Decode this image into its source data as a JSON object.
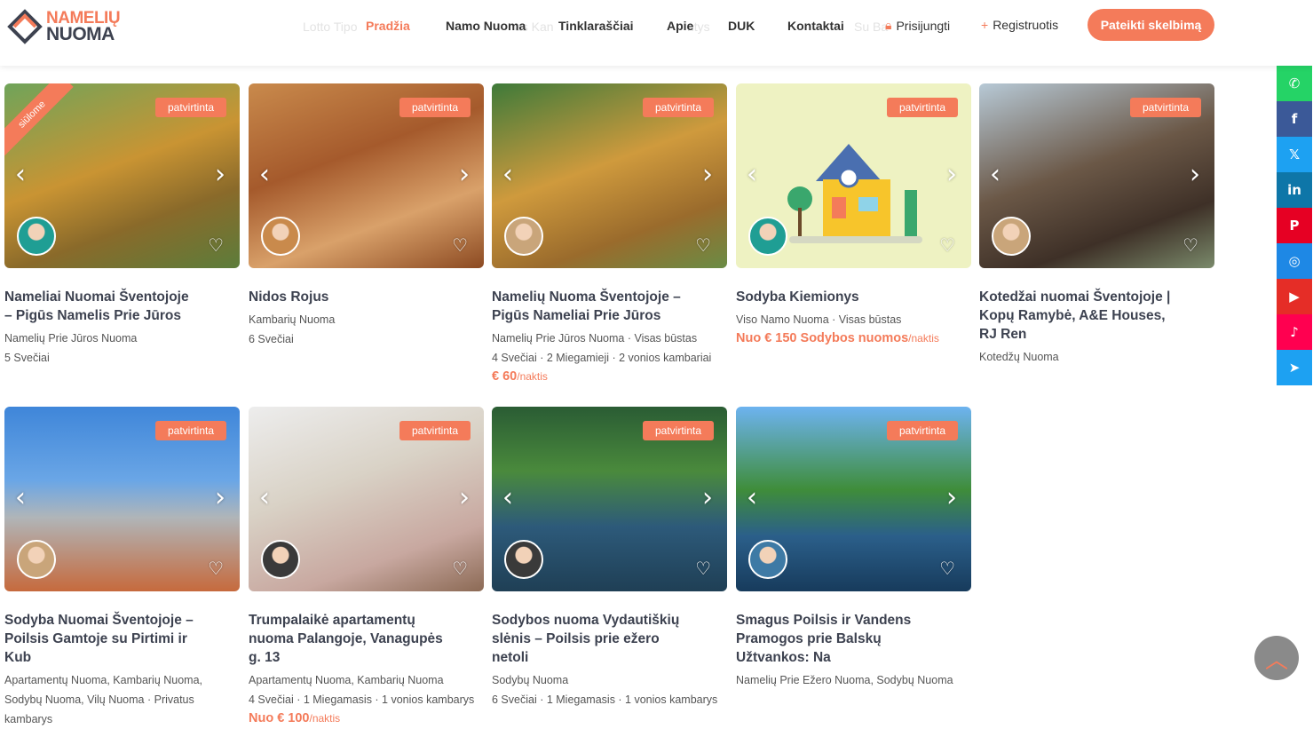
{
  "header": {
    "logo": {
      "line1": "NAMELIŲ",
      "line2": "NUOMA"
    },
    "ghost_links": [
      "Lotto Tipo",
      "as Kan",
      "ntys",
      "Su Ba"
    ],
    "nav": [
      "Pradžia",
      "Namo Nuoma",
      "Tinklaraščiai",
      "Apie",
      "DUK",
      "Kontaktai"
    ],
    "login": "Prisijungti",
    "register": "Registruotis",
    "cta": "Pateikti skelbimą"
  },
  "badge_label": "patvirtinta",
  "ribbon_label": "siūlome",
  "listings": [
    {
      "title": "Nameliai Nuomai Šventojoje – Pigūs Namelis Prie Jūros",
      "sub1": "Namelių Prie Jūros Nuoma",
      "sub2": "5 Svečiai",
      "price": "",
      "unit": ""
    },
    {
      "title": "Nidos Rojus",
      "sub1": "Kambarių Nuoma",
      "sub2": "6 Svečiai",
      "price": "",
      "unit": ""
    },
    {
      "title": "Namelių Nuoma Šventojoje – Pigūs Nameliai Prie Jūros",
      "sub1": "Namelių Prie Jūros Nuoma · Visas būstas",
      "sub2": "4 Svečiai · 2 Miegamieji · 2 vonios kambariai",
      "price": "€ 60",
      "unit": "/naktis"
    },
    {
      "title": "Sodyba Kiemionys",
      "sub1": "Viso Namo Nuoma · Visas būstas",
      "sub2": "",
      "price": "Nuo € 150 Sodybos nuomos",
      "unit": "/naktis"
    },
    {
      "title": "Kotedžai nuomai Šventojoje | Kopų Ramybė, A&E Houses, RJ Ren",
      "sub1": "Kotedžų Nuoma",
      "sub2": "",
      "price": "",
      "unit": ""
    },
    {
      "title": "Sodyba Nuomai Šventojoje – Poilsis Gamtoje su Pirtimi ir Kub",
      "sub1": "Apartamentų Nuoma, Kambarių Nuoma, Sodybų Nuoma, Vilų Nuoma · Privatus kambarys",
      "sub2": "",
      "price": "",
      "unit": ""
    },
    {
      "title": "Trumpalaikė apartamentų nuoma Palangoje, Vanagupės g. 13",
      "sub1": "Apartamentų Nuoma, Kambarių Nuoma",
      "sub2": "4 Svečiai · 1 Miegamasis · 1 vonios kambarys",
      "price": "Nuo € 100",
      "unit": "/naktis"
    },
    {
      "title": "Sodybos nuoma Vydautiškių slėnis – Poilsis prie ežero netoli",
      "sub1": "Sodybų Nuoma",
      "sub2": "6 Svečiai · 1 Miegamasis · 1 vonios kambarys",
      "price": "",
      "unit": ""
    },
    {
      "title": "Smagus Poilsis ir Vandens Pramogos prie Balskų Užtvankos: Na",
      "sub1": "Namelių Prie Ežero Nuoma, Sodybų Nuoma",
      "sub2": "",
      "price": "",
      "unit": ""
    }
  ],
  "social": [
    {
      "name": "whatsapp-icon",
      "color": "#25d366",
      "glyph": "✆"
    },
    {
      "name": "facebook-icon",
      "color": "#3b5998",
      "glyph": "f"
    },
    {
      "name": "x-twitter-icon",
      "color": "#1da1f2",
      "glyph": "𝕏"
    },
    {
      "name": "linkedin-icon",
      "color": "#0e76a8",
      "glyph": "in"
    },
    {
      "name": "pinterest-icon",
      "color": "#e60023",
      "glyph": "P"
    },
    {
      "name": "instagram-icon",
      "color": "#1e88e5",
      "glyph": "◎"
    },
    {
      "name": "youtube-icon",
      "color": "#e52d27",
      "glyph": "▶"
    },
    {
      "name": "tiktok-icon",
      "color": "#ff0050",
      "glyph": "♪"
    },
    {
      "name": "telegram-icon",
      "color": "#1da1f2",
      "glyph": "➤"
    }
  ],
  "colors": {
    "accent": "#f47b5a",
    "dark": "#3d4250"
  }
}
